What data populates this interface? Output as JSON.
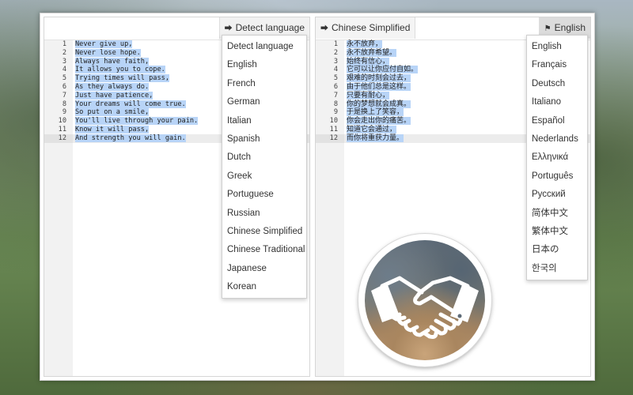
{
  "source_pane": {
    "language_button": "Detect language",
    "line_numbers": [
      "1",
      "2",
      "3",
      "4",
      "5",
      "6",
      "7",
      "8",
      "9",
      "10",
      "11",
      "12"
    ],
    "lines": [
      "Never give up,",
      "Never lose hope.",
      "Always have faith,",
      "It allows you to cope.",
      "Trying times will pass,",
      "As they always do.",
      "Just have patience,",
      "Your dreams will come true.",
      "So put on a smile,",
      "You'll live through your pain.",
      "Know it will pass,",
      "And strength you will gain."
    ],
    "dropdown": [
      "Detect language",
      "English",
      "French",
      "German",
      "Italian",
      "Spanish",
      "Dutch",
      "Greek",
      "Portuguese",
      "Russian",
      "Chinese Simplified",
      "Chinese Traditional",
      "Japanese",
      "Korean"
    ]
  },
  "target_pane": {
    "source_language_button": "Chinese Simplified",
    "target_language_button": "English",
    "line_numbers": [
      "1",
      "2",
      "3",
      "4",
      "5",
      "6",
      "7",
      "8",
      "9",
      "10",
      "11",
      "12"
    ],
    "lines": [
      "永不放弃，",
      "永不放弃希望。",
      "始终有信心，",
      "它可以让你应付自如。",
      "艰难的时刻会过去，",
      "由于他们总是这样。",
      "只要有耐心，",
      "你的梦想就会成真。",
      "于是换上了笑容，",
      "你会走出你的痛苦。",
      "知道它会通过，",
      "而你将重获力量。"
    ],
    "dropdown": [
      "English",
      "Français",
      "Deutsch",
      "Italiano",
      "Español",
      "Nederlands",
      "Ελληνικά",
      "Português",
      "Русский",
      "简体中文",
      "繁体中文",
      "日本の",
      "한국의"
    ]
  },
  "icons": {
    "source_icon": "sign-in-icon",
    "target_icon": "flag-icon",
    "app_logo": "handshake-icon"
  },
  "colors": {
    "selection": "#b8d4f7",
    "gutter": "#f2f2f2",
    "active_button": "#dcdcdc"
  }
}
